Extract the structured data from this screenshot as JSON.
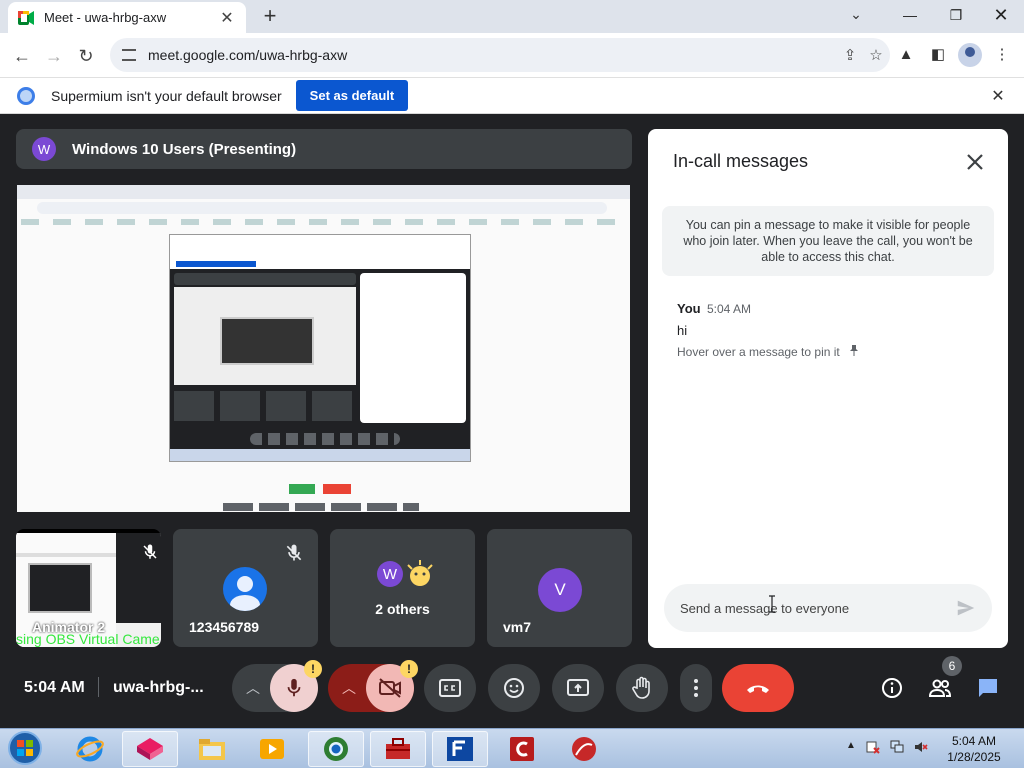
{
  "browser": {
    "tab_title": "Meet - uwa-hrbg-axw",
    "url": "meet.google.com/uwa-hrbg-axw",
    "infobar_text": "Supermium isn't your default browser",
    "infobar_button": "Set as default"
  },
  "meet": {
    "presenter_initial": "W",
    "presenter_label": "Windows 10 Users (Presenting)",
    "tiles": {
      "self_name": "Animator 2",
      "self_obs_text": "sing OBS Virtual Came",
      "tile1_name": "123456789",
      "tile2_initial": "W",
      "tile2_name": "2 others",
      "tile3_initial": "V",
      "tile3_name": "vm7"
    },
    "clock": "5:04 AM",
    "meeting_code": "uwa-hrbg-...",
    "warning_mark": "!",
    "people_count": "6"
  },
  "chat": {
    "title": "In-call messages",
    "info_note": "You can pin a message to make it visible for people who join later. When you leave the call, you won't be able to access this chat.",
    "messages": [
      {
        "sender": "You",
        "time": "5:04 AM",
        "text": "hi",
        "hint": "Hover over a message to pin it"
      }
    ],
    "input_placeholder": "Send a message to everyone"
  },
  "taskbar": {
    "time": "5:04 AM",
    "date": "1/28/2025"
  },
  "colors": {
    "accent": "#0b57d0",
    "meet_bg": "#202124",
    "tile_bg": "#3c4043",
    "end_call": "#ea4335",
    "avatar_purple": "#7b49d4"
  }
}
